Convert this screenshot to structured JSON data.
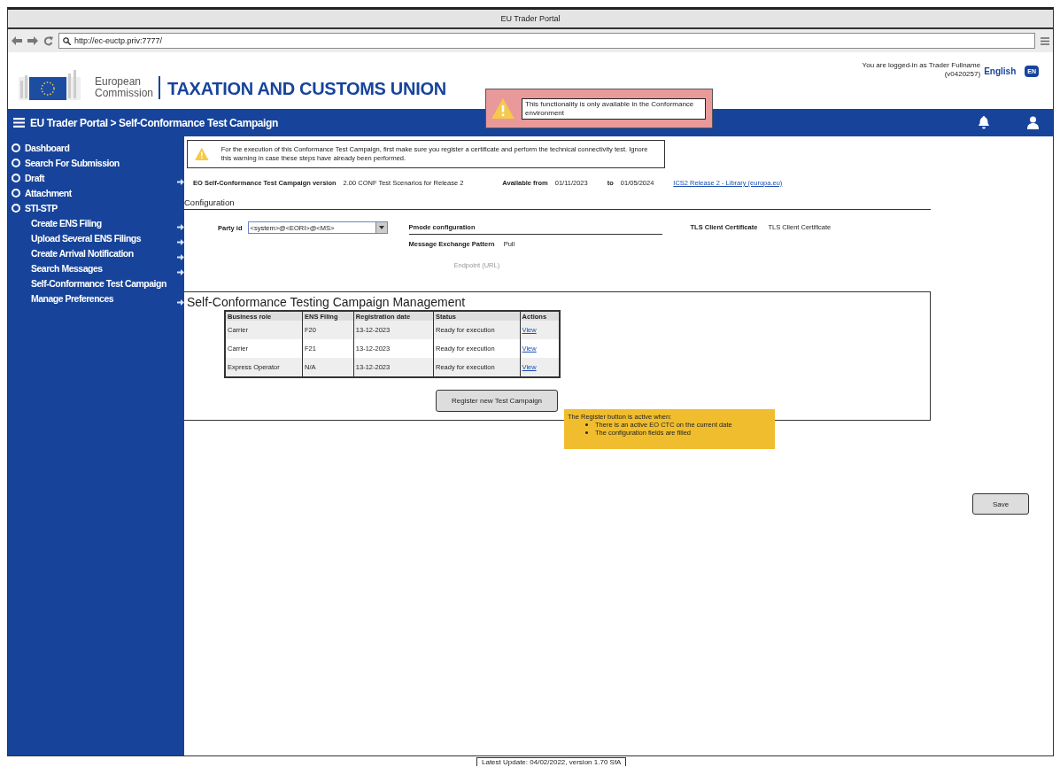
{
  "window": {
    "title": "EU Trader Portal"
  },
  "browser": {
    "url": "http://ec-euctp.priv:7777/"
  },
  "header": {
    "logo_line1": "European",
    "logo_line2": "Commission",
    "title": "TAXATION AND CUSTOMS UNION",
    "user_line1": "You are logged-in as Trader Fullname",
    "user_line2": "(v0420257)",
    "language": "English",
    "language_badge": "EN"
  },
  "nav": {
    "title": "EU Trader Portal > Self-Conformance Test Campaign"
  },
  "env_warning": "This functionality is only available in the Conformance environment",
  "sidebar": {
    "items": [
      {
        "label": "Dashboard",
        "arrow": false
      },
      {
        "label": "Search For Submission",
        "arrow": false
      },
      {
        "label": "Draft",
        "arrow": true
      },
      {
        "label": "Attachment",
        "arrow": false
      },
      {
        "label": "STI-STP",
        "arrow": false,
        "children": [
          {
            "label": "Create ENS Filing",
            "arrow": true
          },
          {
            "label": "Upload Several ENS Filings",
            "arrow": true
          },
          {
            "label": "Create Arrival Notification",
            "arrow": true
          },
          {
            "label": "Search Messages",
            "arrow": true
          },
          {
            "label": "Self-Conformance Test Campaign",
            "arrow": false
          },
          {
            "label": "Manage Preferences",
            "arrow": true
          }
        ]
      }
    ]
  },
  "warning": "For the execution of this Conformance Test Campaign, first make sure you register a certificate and perform the technical connectivity test. Ignore this warning in case these steps have already been performed.",
  "campaign": {
    "label": "EO Self-Conformance Test Campaign version",
    "version": "2.00 CONF Test Scenarios for Release 2",
    "from_label": "Available from",
    "from": "01/11/2023",
    "to_label": "to",
    "to": "01/05/2024",
    "link": "ICS2 Release 2 - Library (europa.eu)"
  },
  "configuration": {
    "title": "Configuration",
    "party_label": "Party id",
    "party_value": "<system>@<EORI>@<MS>",
    "pmode_title": "Pmode configuration",
    "mep_label": "Message Exchange Pattern",
    "mep_value": "Pull",
    "endpoint_label": "Endpoint (URL)",
    "tls_label": "TLS Client Certificate",
    "tls_value": "TLS Client Certificate"
  },
  "management": {
    "title": "Self-Conformance Testing Campaign Management",
    "columns": [
      "Business role",
      "ENS Filing",
      "Registration date",
      "Status",
      "Actions"
    ],
    "rows": [
      {
        "cells": [
          "Carrier",
          "F20",
          "13-12-2023",
          "Ready for execution"
        ],
        "action": "View"
      },
      {
        "cells": [
          "Carrier",
          "F21",
          "13-12-2023",
          "Ready for execution"
        ],
        "action": "View"
      },
      {
        "cells": [
          "Express Operator",
          "N/A",
          "13-12-2023",
          "Ready for execution"
        ],
        "action": "View"
      }
    ],
    "register_button": "Register new Test Campaign"
  },
  "note": {
    "title": "The Register button is active when:",
    "items": [
      "There is an active EO CTC on the current date",
      "The configuration fields are filled"
    ]
  },
  "save_button": "Save",
  "footer": "Latest Update: 04/02/2022, version 1.70 SfA"
}
